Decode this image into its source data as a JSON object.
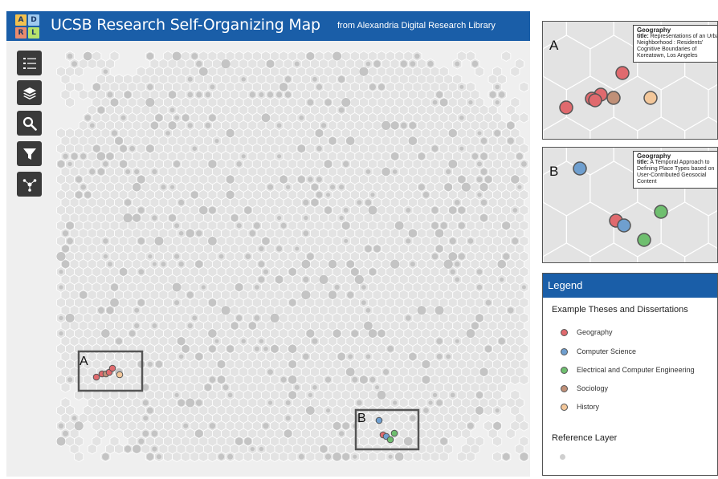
{
  "header": {
    "logo_letters": [
      "A",
      "D",
      "R",
      "L"
    ],
    "logo_colors": [
      "#f2c14e",
      "#9fc9ee",
      "#e98b6d",
      "#b7e26b"
    ],
    "title": "UCSB Research Self-Organizing Map",
    "subtitle": "from Alexandria Digital Research Library",
    "background": "#1a5ea8"
  },
  "toolbar": [
    {
      "icon": "list-icon"
    },
    {
      "icon": "layers-icon"
    },
    {
      "icon": "search-icon"
    },
    {
      "icon": "filter-icon"
    },
    {
      "icon": "share-nodes-icon"
    }
  ],
  "map": {
    "region_a_label": "A",
    "region_b_label": "B"
  },
  "inset_a": {
    "letter": "A",
    "tooltip": {
      "category": "Geography",
      "title_key": "title:",
      "title_value": "Representations of an Urban Neighborhood : Residents' Cognitive Boundaries of Koreatown, Los Angeles"
    }
  },
  "inset_b": {
    "letter": "B",
    "tooltip": {
      "category": "Geography",
      "title_key": "title:",
      "title_value": "A Temporal Approach to Defining Place Types based on User-Contributed Geosocial Content"
    }
  },
  "legend": {
    "header": "Legend",
    "section_examples": "Example Theses and Dissertations",
    "items": [
      {
        "label": "Geography",
        "color": "#e06a6e"
      },
      {
        "label": "Computer Science",
        "color": "#6f9fcf"
      },
      {
        "label": "Electrical and Computer Engineering",
        "color": "#6fbf6f"
      },
      {
        "label": "Sociology",
        "color": "#c09078"
      },
      {
        "label": "History",
        "color": "#f3c79a"
      }
    ],
    "section_reference": "Reference Layer",
    "reference_color": "#cfcfcf"
  },
  "colors": {
    "hex_fill": "#e3e3e3",
    "hex_stroke": "#ffffff",
    "reference_point": "#c4c4c4",
    "region_box": "#555555"
  }
}
